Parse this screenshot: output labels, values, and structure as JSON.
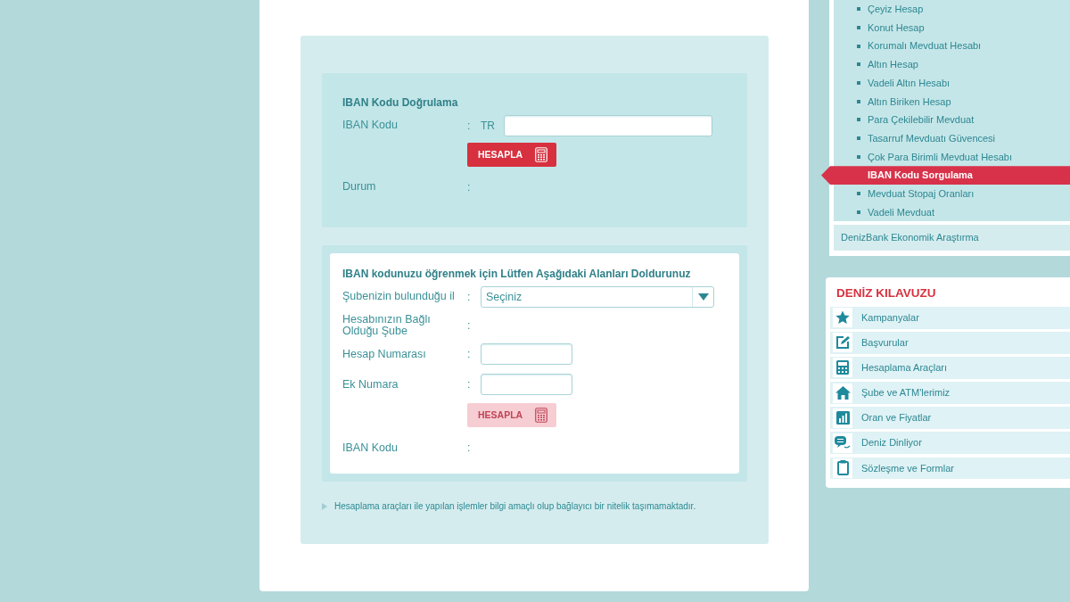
{
  "verify": {
    "title": "IBAN Kodu Doğrulama",
    "rows": [
      {
        "kind": "wide_input",
        "label": "IBAN Kodu",
        "separator": ":",
        "prefix": "TR"
      },
      {
        "kind": "button",
        "label": "HESAPLA",
        "disabled": false
      },
      {
        "kind": "output",
        "label": "Durum",
        "separator": ":"
      }
    ]
  },
  "lookup": {
    "title": "IBAN kodunuzu öğrenmek için Lütfen Aşağıdaki Alanları Doldurunuz",
    "rows": [
      {
        "kind": "select",
        "label": "Şubenizin bulunduğu il",
        "separator": ":",
        "value": "Seçiniz"
      },
      {
        "kind": "output",
        "label": "Hesabınızın Bağlı Olduğu Şube",
        "separator": ":"
      },
      {
        "kind": "input",
        "label": "Hesap Numarası",
        "separator": ":"
      },
      {
        "kind": "input",
        "label": "Ek Numara",
        "separator": ":"
      },
      {
        "kind": "button",
        "label": "HESAPLA",
        "disabled": true
      },
      {
        "kind": "output",
        "label": "IBAN Kodu",
        "separator": ":"
      }
    ]
  },
  "note": "Hesaplama araçları ile yapılan işlemler bilgi amaçlı olup bağlayıcı bir nitelik taşımamaktadır.",
  "sidebar": {
    "items": [
      {
        "label": "Çeyiz Hesap",
        "selected": false
      },
      {
        "label": "Konut Hesap",
        "selected": false
      },
      {
        "label": "Korumalı Mevduat Hesabı",
        "selected": false
      },
      {
        "label": "Altın Hesap",
        "selected": false
      },
      {
        "label": "Vadeli Altın Hesabı",
        "selected": false
      },
      {
        "label": "Altın Biriken Hesap",
        "selected": false
      },
      {
        "label": "Para Çekilebilir Mevduat",
        "selected": false
      },
      {
        "label": "Tasarruf Mevduatı Güvencesi",
        "selected": false
      },
      {
        "label": "Çok Para Birimli Mevduat Hesabı",
        "selected": false
      },
      {
        "label": "IBAN Kodu Sorgulama",
        "selected": true
      },
      {
        "label": "Mevduat Stopaj Oranları",
        "selected": false
      },
      {
        "label": "Vadeli Mevduat",
        "selected": false
      }
    ],
    "footer_link": "DenizBank Ekonomik Araştırma"
  },
  "guide": {
    "title": "DENİZ KILAVUZU",
    "items": [
      {
        "label": "Kampanyalar"
      },
      {
        "label": "Başvurular"
      },
      {
        "label": "Hesaplama Araçları"
      },
      {
        "label": "Şube ve ATM'lerimiz"
      },
      {
        "label": "Oran ve Fiyatlar"
      },
      {
        "label": "Deniz Dinliyor"
      },
      {
        "label": "Sözleşme ve Formlar"
      }
    ]
  }
}
